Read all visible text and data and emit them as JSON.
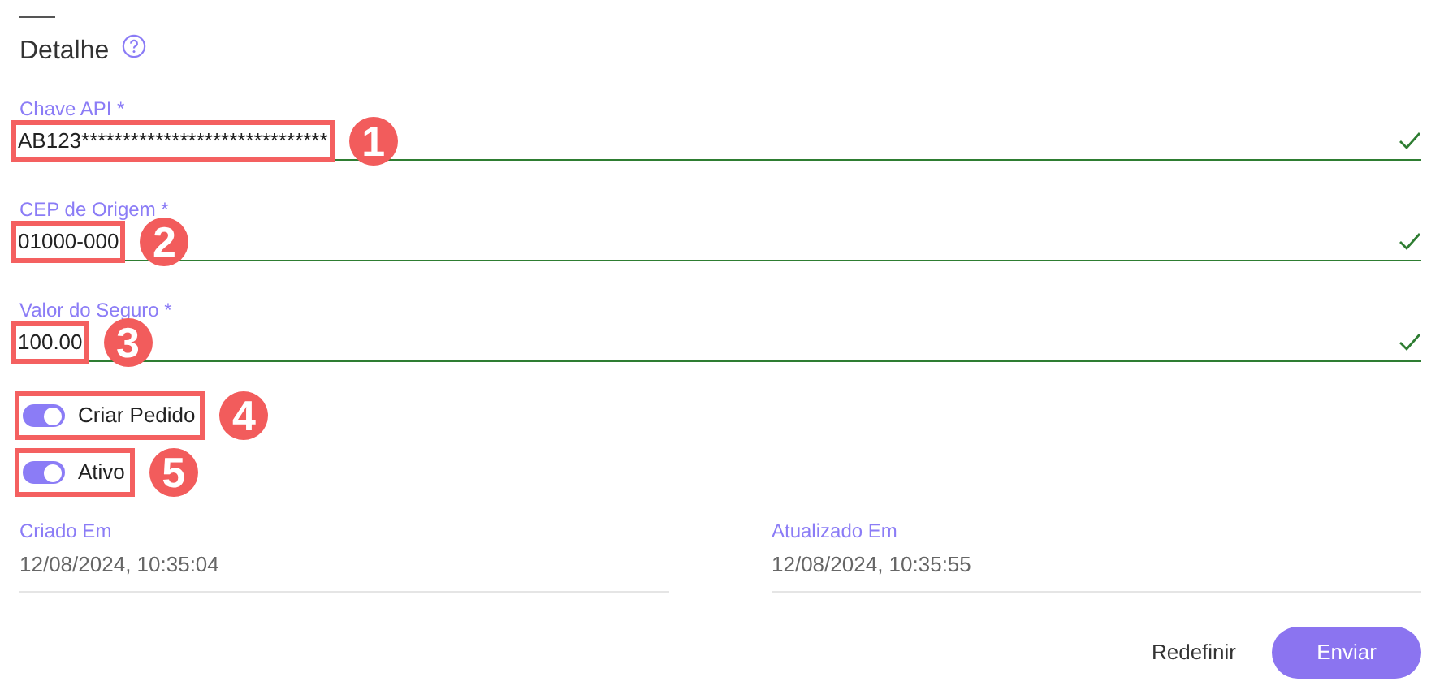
{
  "section": {
    "title": "Detalhe"
  },
  "fields": [
    {
      "label": "Chave API *",
      "value": "AB123******************************",
      "valid": true,
      "annotation": "1"
    },
    {
      "label": "CEP de Origem *",
      "value": "01000-000",
      "valid": true,
      "annotation": "2"
    },
    {
      "label": "Valor do Seguro *",
      "value": "100.00",
      "valid": true,
      "annotation": "3"
    }
  ],
  "toggles": [
    {
      "label": "Criar Pedido",
      "on": true,
      "annotation": "4"
    },
    {
      "label": "Ativo",
      "on": true,
      "annotation": "5"
    }
  ],
  "meta": [
    {
      "label": "Criado Em",
      "value": "12/08/2024, 10:35:04"
    },
    {
      "label": "Atualizado Em",
      "value": "12/08/2024, 10:35:55"
    }
  ],
  "buttons": [
    {
      "label": "Redefinir",
      "kind": "text"
    },
    {
      "label": "Enviar",
      "kind": "primary"
    }
  ]
}
